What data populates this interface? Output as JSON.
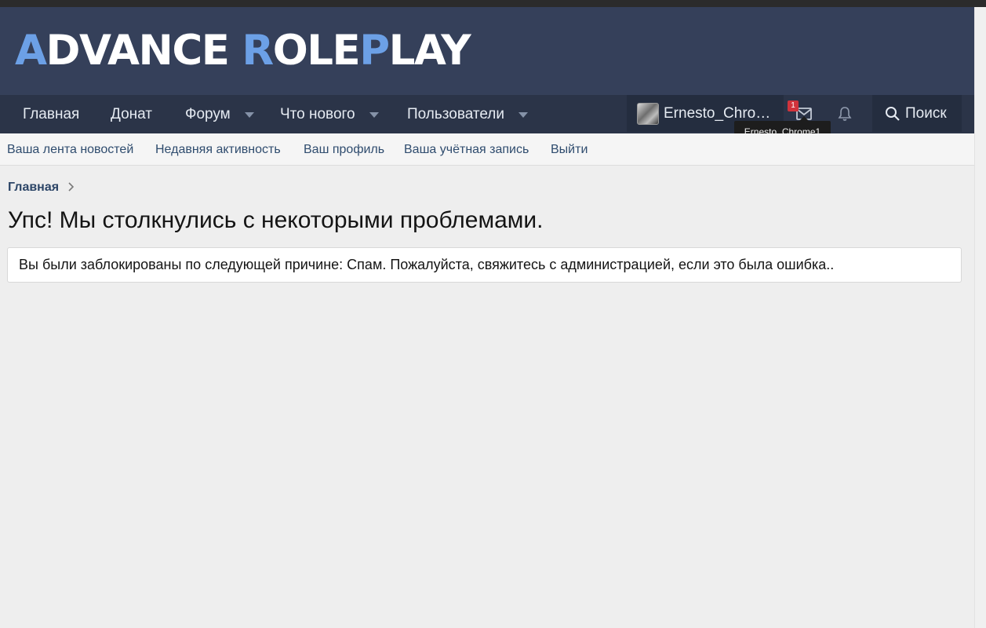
{
  "header": {
    "logo": {
      "parts": [
        {
          "text": "A",
          "tone": "blue"
        },
        {
          "text": "DVANCE ",
          "tone": "white"
        },
        {
          "text": "R",
          "tone": "blue"
        },
        {
          "text": "OLE",
          "tone": "white"
        },
        {
          "text": "P",
          "tone": "blue"
        },
        {
          "text": "LAY",
          "tone": "white"
        }
      ],
      "colors": {
        "white": "#ffffff",
        "blue": "#6ca0e6"
      }
    }
  },
  "nav": {
    "tabs": [
      {
        "label": "Главная",
        "has_dropdown": false
      },
      {
        "label": "Донат",
        "has_dropdown": false
      },
      {
        "label": "Форум",
        "has_dropdown": true
      },
      {
        "label": "Что нового",
        "has_dropdown": true
      },
      {
        "label": "Пользователи",
        "has_dropdown": true
      }
    ],
    "user": {
      "name": "Ernesto_Chro…",
      "avatar_icon": "avatar-photo"
    },
    "inbox": {
      "icon": "envelope-icon",
      "badge_count": "1"
    },
    "alerts": {
      "icon": "bell-icon"
    },
    "search": {
      "label": "Поиск",
      "icon": "search-icon"
    },
    "tooltip": "Ernesto_Chrome1"
  },
  "subnav": {
    "links": [
      "Ваша лента новостей",
      "Недавняя активность",
      "Ваш профиль",
      "Ваша учётная запись",
      "Выйти"
    ]
  },
  "breadcrumb": {
    "label": "Главная"
  },
  "page": {
    "title": "Упс! Мы столкнулись с некоторыми проблемами.",
    "notice": "Вы были заблокированы по следующей причине: Спам. Пожалуйста, свяжитесь с администрацией, если это была ошибка.."
  },
  "colors": {
    "header_bg": "#35405a",
    "nav_bg": "#2b3448",
    "accent": "#6ca0e6",
    "badge": "#d0333c",
    "link": "#2f4c6e"
  }
}
